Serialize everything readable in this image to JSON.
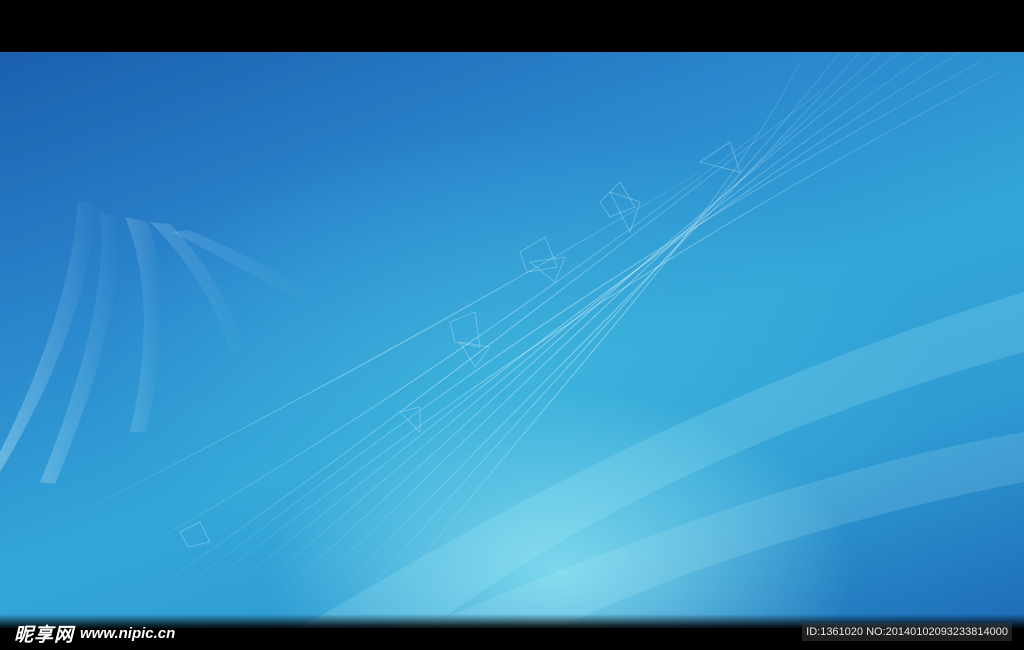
{
  "watermark": {
    "logo_cn": "昵享网",
    "logo_url": "www.nipic.cn",
    "image_id": "ID:1361020 NO:20140102093233814000"
  },
  "colors": {
    "background_deep": "#1a5fae",
    "background_mid": "#33a6d8",
    "highlight": "#96ebf5",
    "letterbox": "#000000"
  }
}
